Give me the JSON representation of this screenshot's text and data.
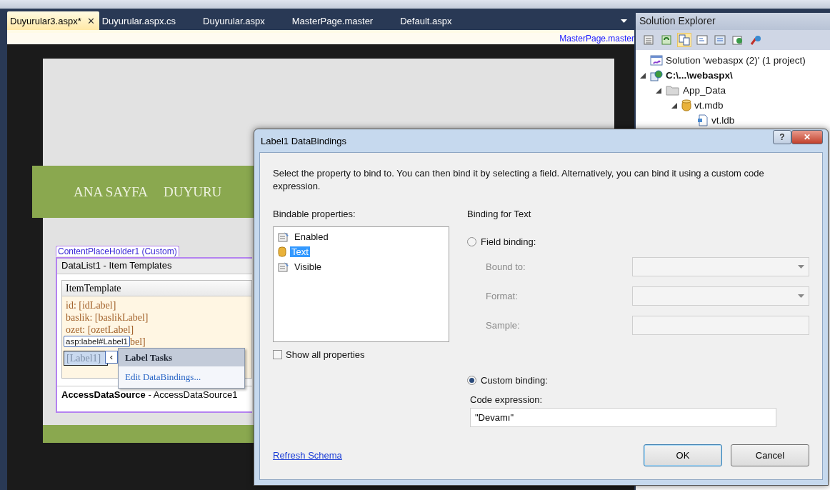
{
  "tabs": [
    {
      "label": "Duyurular3.aspx*",
      "selected": true,
      "close": "✕"
    },
    {
      "label": "Duyurular.aspx.cs",
      "selected": false
    },
    {
      "label": "Duyurular.aspx",
      "selected": false
    },
    {
      "label": "MasterPage.master",
      "selected": false
    },
    {
      "label": "Default.aspx",
      "selected": false
    }
  ],
  "editor": {
    "master_link": "MasterPage.master",
    "menu": [
      "ANA SAYFA",
      "DUYURU"
    ],
    "placeholder_tag": "ContentPlaceHolder1 (Custom)",
    "datalist_header": "DataList1 - Item Templates",
    "template_header": "ItemTemplate",
    "template_lines": [
      "id: [idLabel]",
      "baslik: [baslikLabel]",
      "ozet: [ozetLabel]"
    ],
    "hidden_line_tail": "bel]",
    "element_tag": "asp:label#Label1",
    "selected_label": "[Label1]",
    "smart_tag": "‹",
    "tasks_menu": {
      "title": "Label Tasks",
      "items": [
        "Edit DataBindings..."
      ]
    },
    "datasource": "**AccessDataSource** - AccessDataSource1"
  },
  "solution_explorer": {
    "title": "Solution Explorer",
    "tree": [
      {
        "label": "Solution 'webaspx (2)' (1 project)",
        "kind": "solution"
      },
      {
        "label": "C:\\...\\webaspx\\",
        "kind": "project",
        "expanded": true,
        "children": [
          {
            "label": "App_Data",
            "kind": "folder",
            "expanded": true,
            "children": [
              {
                "label": "vt.mdb",
                "kind": "database",
                "expanded": true,
                "children": [
                  {
                    "label": "vt.ldb",
                    "kind": "file"
                  }
                ]
              }
            ]
          }
        ]
      }
    ]
  },
  "dialog": {
    "title": "Label1 DataBindings",
    "help": "?",
    "close": "✕",
    "instructions": "Select the property to bind to. You can then bind it by selecting a field. Alternatively, you can bind it using a custom code expression.",
    "bindable_label": "Bindable properties:",
    "properties": [
      {
        "label": "Enabled",
        "kind": "property",
        "selected": false
      },
      {
        "label": "Text",
        "kind": "bound",
        "selected": true
      },
      {
        "label": "Visible",
        "kind": "property",
        "selected": false
      }
    ],
    "show_all": {
      "label": "Show all properties",
      "checked": false
    },
    "binding_title": "Binding for Text",
    "field_binding": {
      "label": "Field binding:",
      "selected": false
    },
    "field_rows": [
      {
        "label": "Bound to:",
        "kind": "dropdown"
      },
      {
        "label": "Format:",
        "kind": "dropdown"
      },
      {
        "label": "Sample:",
        "kind": "text"
      }
    ],
    "custom_binding": {
      "label": "Custom binding:",
      "selected": true
    },
    "code_label": "Code expression:",
    "code_value": "\"Devamı\"",
    "refresh_link": "Refresh Schema",
    "buttons": [
      "OK",
      "Cancel"
    ]
  }
}
